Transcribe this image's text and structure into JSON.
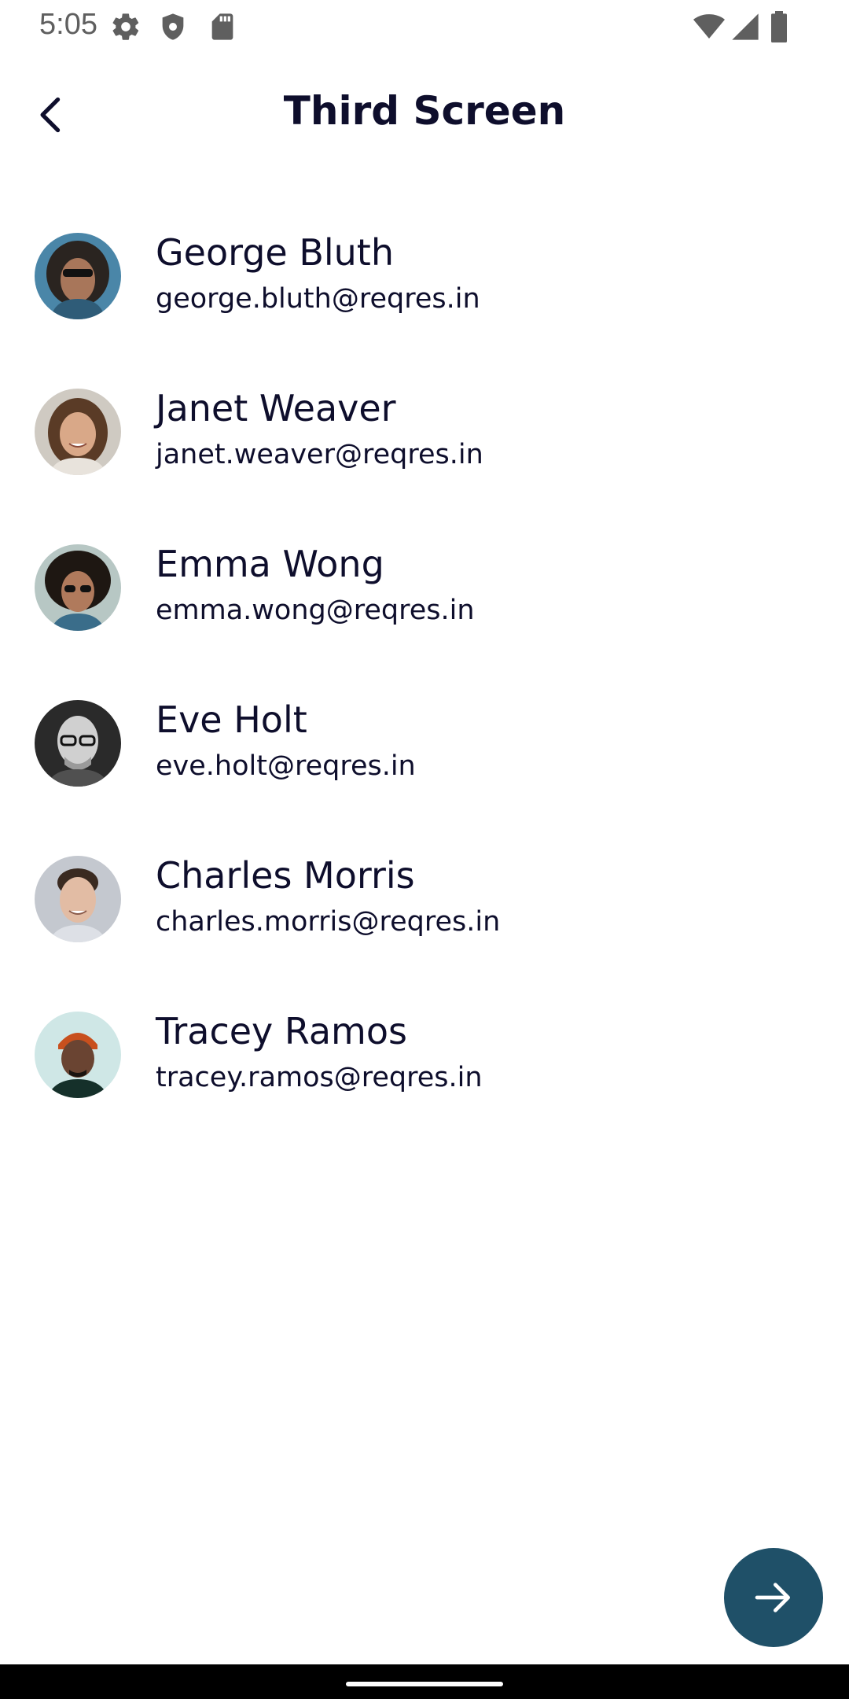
{
  "status_bar": {
    "time": "5:05",
    "left_icons": [
      "gear-icon",
      "shield-icon",
      "sd-card-icon"
    ],
    "right_icons": [
      "wifi-icon",
      "cellular-signal-icon",
      "battery-icon"
    ]
  },
  "app_bar": {
    "title": "Third Screen",
    "back_icon": "chevron-left-icon"
  },
  "users": [
    {
      "name": "George Bluth",
      "email": "george.bluth@reqres.in"
    },
    {
      "name": "Janet Weaver",
      "email": "janet.weaver@reqres.in"
    },
    {
      "name": "Emma Wong",
      "email": "emma.wong@reqres.in"
    },
    {
      "name": "Eve Holt",
      "email": "eve.holt@reqres.in"
    },
    {
      "name": "Charles Morris",
      "email": "charles.morris@reqres.in"
    },
    {
      "name": "Tracey Ramos",
      "email": "tracey.ramos@reqres.in"
    }
  ],
  "fab": {
    "icon": "arrow-right-icon"
  },
  "colors": {
    "text": "#0e0e2c",
    "fab_background": "#1f5068",
    "status_text": "#5f5f5f",
    "nav_bar": "#000000"
  }
}
